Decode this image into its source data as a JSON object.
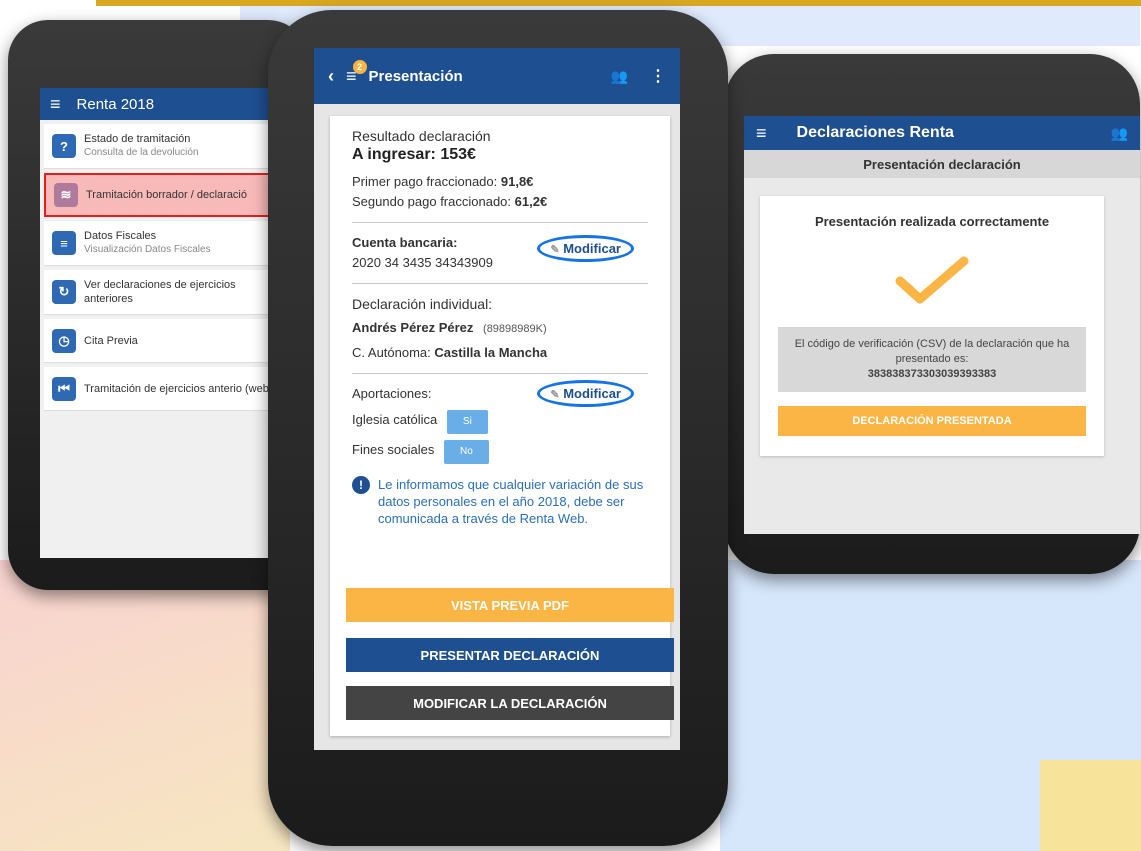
{
  "left_app": {
    "title": "Renta 2018",
    "items": [
      {
        "icon": "?",
        "label": "Estado de tramitación",
        "sub": "Consulta de la devolución"
      },
      {
        "icon": "≋",
        "label": "Tramitación borrador / declaració",
        "sub": ""
      },
      {
        "icon": "≡",
        "label": "Datos Fiscales",
        "sub": "Visualización Datos Fiscales"
      },
      {
        "icon": "↻",
        "label": "Ver declaraciones de ejercicios anteriores",
        "sub": ""
      },
      {
        "icon": "◷",
        "label": "Cita Previa",
        "sub": ""
      },
      {
        "icon": "⏮",
        "label": "Tramitación de ejercicios anterio (web)",
        "sub": ""
      }
    ]
  },
  "center_app": {
    "title": "Presentación",
    "notif_count": "2",
    "result_label": "Resultado declaración",
    "result_value": "A ingresar: 153€",
    "first_payment_label": "Primer pago fraccionado:",
    "first_payment_value": "91,8€",
    "second_payment_label": "Segundo pago fraccionado:",
    "second_payment_value": "61,2€",
    "bank_label": "Cuenta bancaria:",
    "bank_account": "2020 34 3435 34343909",
    "modify_label": "Modificar",
    "individual_label": "Declaración individual:",
    "person_name": "Andrés Pérez Pérez",
    "person_id": "(89898989K)",
    "region_label": "C. Autónoma:",
    "region_value": "Castilla la Mancha",
    "contributions_label": "Aportaciones:",
    "church_label": "Iglesia católica",
    "church_value": "Si",
    "social_label": "Fines sociales",
    "social_value": "No",
    "info_text": "Le informamos que cualquier variación de sus datos personales en el año 2018, debe ser comunicada a través de Renta Web.",
    "btn_preview": "VISTA PREVIA PDF",
    "btn_submit": "PRESENTAR DECLARACIÓN",
    "btn_modify": "MODIFICAR LA DECLARACIÓN"
  },
  "right_app": {
    "title": "Declaraciones Renta",
    "subheader": "Presentación declaración",
    "success_text": "Presentación realizada correctamente",
    "csv_text": "El código de verificación (CSV) de la declaración que ha presentado es:",
    "csv_code": "383838373303039393383",
    "btn_done": "DECLARACIÓN PRESENTADA"
  },
  "colors": {
    "primary": "#1d4f91",
    "accent": "#fbb545",
    "dark_button": "#444444",
    "highlight_ring": "#1473e6"
  }
}
